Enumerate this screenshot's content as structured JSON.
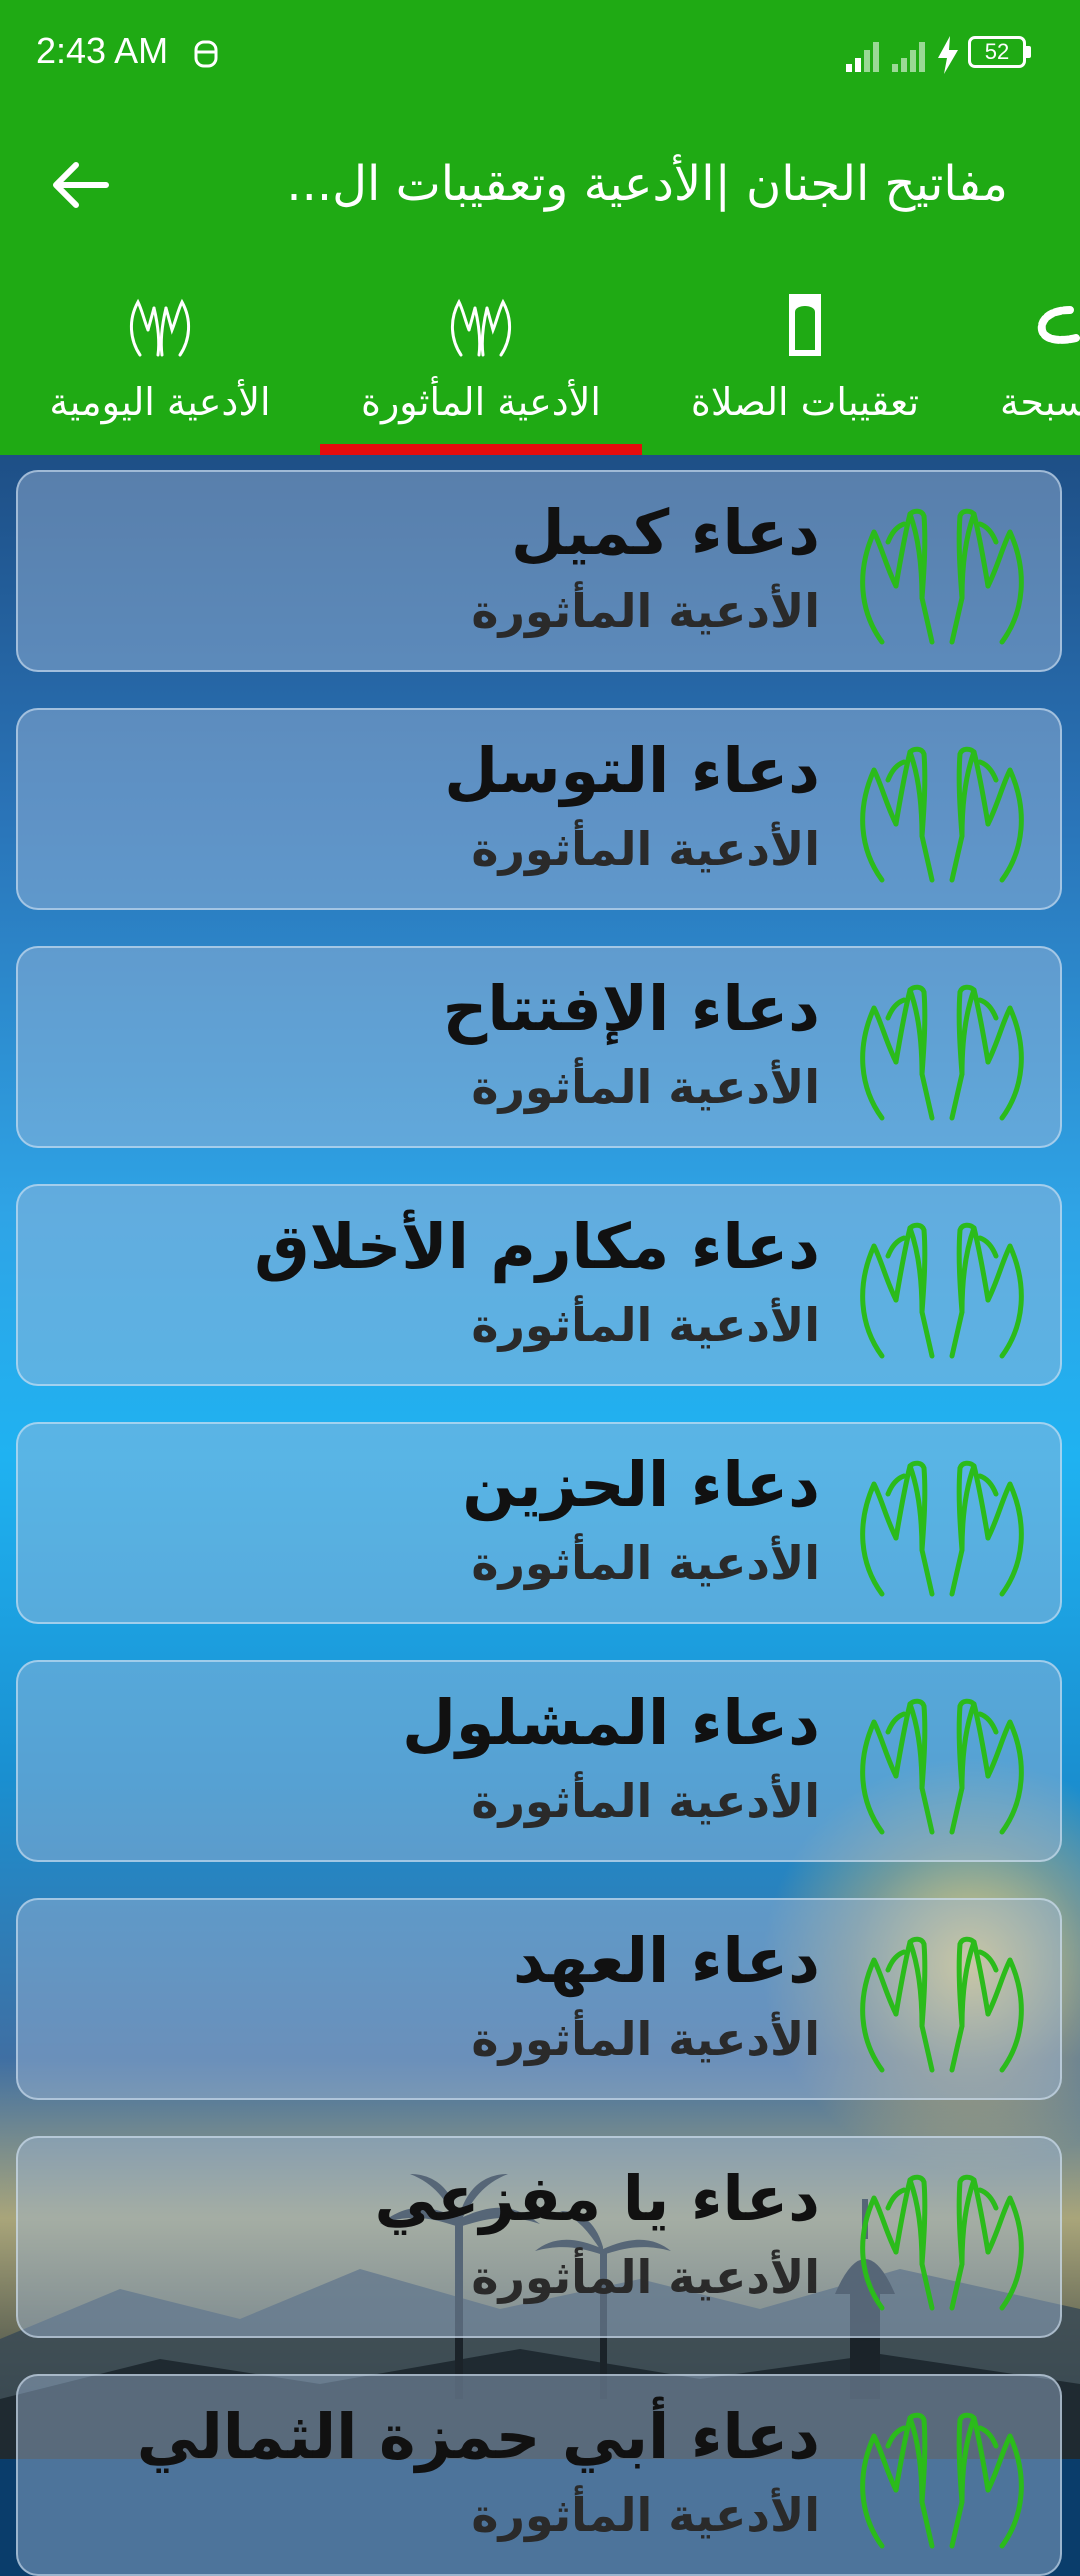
{
  "status_bar": {
    "time": "2:43 AM",
    "battery": "52"
  },
  "toolbar": {
    "title": "مفاتيح الجنان |الأدعية وتعقيبات ال..."
  },
  "tabs": [
    {
      "label": "الأدعية اليومية",
      "icon": "praying-hands-icon",
      "selected": false
    },
    {
      "label": "الأدعية المأثورة",
      "icon": "praying-hands-icon",
      "selected": true
    },
    {
      "label": "تعقيبات الصلاة",
      "icon": "prayer-rug-icon",
      "selected": false
    },
    {
      "label": "سبحة",
      "icon": "prayer-beads-icon",
      "selected": false
    }
  ],
  "list": {
    "items": [
      {
        "title": "دعاء كميل",
        "subtitle": "الأدعية المأثورة"
      },
      {
        "title": "دعاء التوسل",
        "subtitle": "الأدعية المأثورة"
      },
      {
        "title": "دعاء الإفتتاح",
        "subtitle": "الأدعية المأثورة"
      },
      {
        "title": "دعاء مكارم الأخلاق",
        "subtitle": "الأدعية المأثورة"
      },
      {
        "title": "دعاء الحزين",
        "subtitle": "الأدعية المأثورة"
      },
      {
        "title": "دعاء المشلول",
        "subtitle": "الأدعية المأثورة"
      },
      {
        "title": "دعاء العهد",
        "subtitle": "الأدعية المأثورة"
      },
      {
        "title": "دعاء يا مفزعي",
        "subtitle": "الأدعية المأثورة"
      },
      {
        "title": "دعاء أبي حمزة الثمالي",
        "subtitle": "الأدعية المأثورة"
      }
    ]
  },
  "colors": {
    "header_green": "#1faa14",
    "tab_indicator": "#e50d0d",
    "hands_icon": "#2bbb1b"
  }
}
